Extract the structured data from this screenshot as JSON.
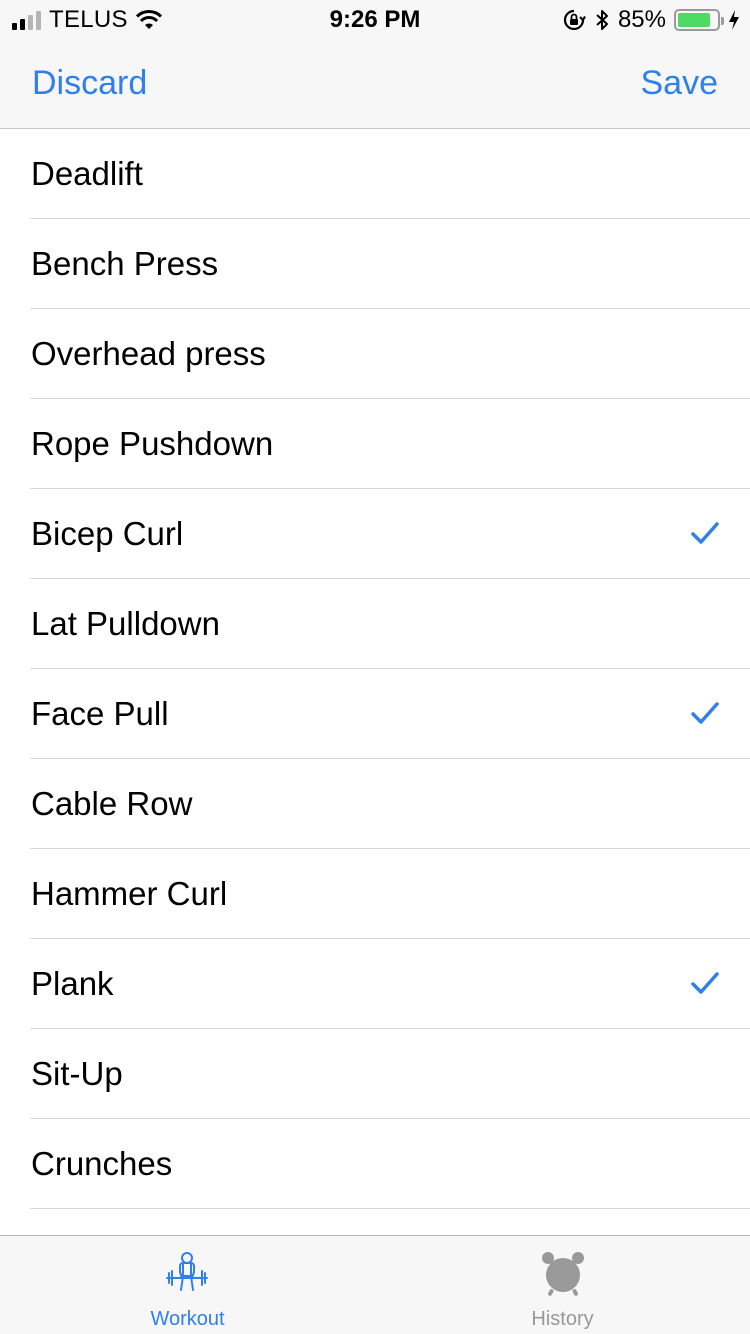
{
  "status_bar": {
    "carrier": "TELUS",
    "time": "9:26 PM",
    "battery_percent": "85%",
    "battery_level": 0.85,
    "signal_bars": 4,
    "signal_bars_filled": 2
  },
  "nav": {
    "discard_label": "Discard",
    "save_label": "Save"
  },
  "exercises": [
    {
      "label": "Deadlift",
      "checked": false
    },
    {
      "label": "Bench Press",
      "checked": false
    },
    {
      "label": "Overhead press",
      "checked": false
    },
    {
      "label": "Rope Pushdown",
      "checked": false
    },
    {
      "label": "Bicep Curl",
      "checked": true
    },
    {
      "label": "Lat Pulldown",
      "checked": false
    },
    {
      "label": "Face Pull",
      "checked": true
    },
    {
      "label": "Cable Row",
      "checked": false
    },
    {
      "label": "Hammer Curl",
      "checked": false
    },
    {
      "label": "Plank",
      "checked": true
    },
    {
      "label": "Sit-Up",
      "checked": false
    },
    {
      "label": "Crunches",
      "checked": false
    }
  ],
  "tabs": [
    {
      "label": "Workout",
      "icon": "weightlifter-icon",
      "active": true
    },
    {
      "label": "History",
      "icon": "alarm-clock-icon",
      "active": false
    }
  ],
  "colors": {
    "accent": "#2f80ed",
    "inactive": "#999999",
    "battery": "#4cd964"
  }
}
